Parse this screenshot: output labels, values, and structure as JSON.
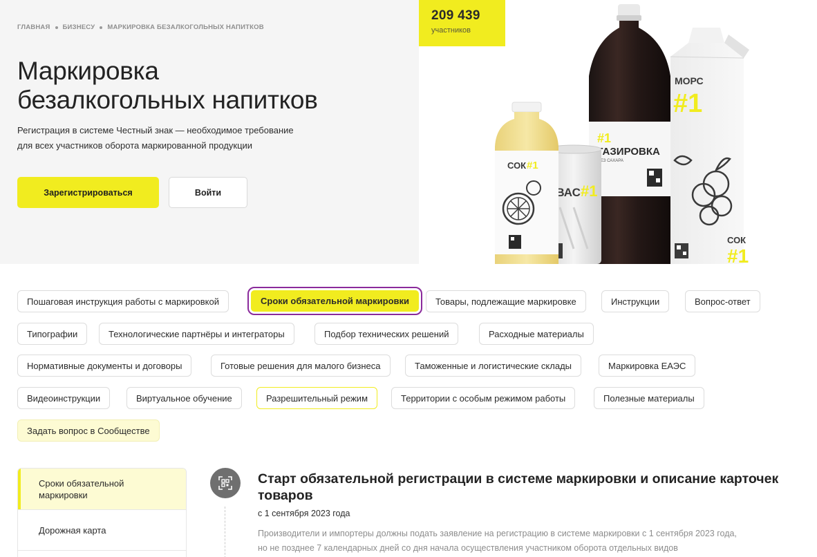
{
  "breadcrumb": {
    "items": [
      "ГЛАВНАЯ",
      "БИЗНЕСУ",
      "МАРКИРОВКА БЕЗАЛКОГОЛЬНЫХ НАПИТКОВ"
    ]
  },
  "hero": {
    "title_line1": "Маркировка",
    "title_line2": "безалкогольных напитков",
    "description_line1": "Регистрация в системе Честный знак — необходимое требование",
    "description_line2": "для всех участников оборота маркированной продукции",
    "register_label": "Зарегистрироваться",
    "login_label": "Войти"
  },
  "counter": {
    "number": "209 439",
    "label": "участников"
  },
  "products": {
    "juice_small_label": "СОК",
    "juice_small_num": "#1",
    "kvas_label": "КВАС",
    "kvas_num": "#1",
    "soda_num": "#1",
    "soda_label": "ГАЗИРОВКА",
    "soda_sub": "БЕЗ САХАРА",
    "mors_label": "МОРС",
    "mors_num": "#1",
    "juice_pack_label": "СОК",
    "juice_pack_num": "#1"
  },
  "tags": [
    {
      "label": "Пошаговая инструкция работы с маркировкой"
    },
    {
      "label": "Сроки обязательной маркировки"
    },
    {
      "label": "Товары, подлежащие маркировке"
    },
    {
      "label": "Инструкции"
    },
    {
      "label": "Вопрос-ответ"
    },
    {
      "label": "Типографии"
    },
    {
      "label": "Технологические партнёры и интеграторы"
    },
    {
      "label": "Подбор технических решений"
    },
    {
      "label": "Расходные материалы"
    },
    {
      "label": "Нормативные документы и договоры"
    },
    {
      "label": "Готовые решения для малого бизнеса"
    },
    {
      "label": "Таможенные и логистические склады"
    },
    {
      "label": "Маркировка ЕАЭС"
    },
    {
      "label": "Видеоинструкции"
    },
    {
      "label": "Виртуальное обучение"
    },
    {
      "label": "Разрешительный режим"
    },
    {
      "label": "Территории с особым режимом работы"
    },
    {
      "label": "Полезные материалы"
    },
    {
      "label": "Задать вопрос в Сообществе"
    }
  ],
  "sidebar": {
    "items": [
      {
        "label_line1": "Сроки обязательной",
        "label_line2": "маркировки"
      },
      {
        "label": "Дорожная карта"
      }
    ]
  },
  "news": {
    "title": "Старт обязательной регистрации в системе маркировки и описание карточек товаров",
    "date": "с 1 сентября 2023 года",
    "text_line1": "Производители и импортеры должны подать заявление на регистрацию в системе маркировки с 1 сентября 2023 года,",
    "text_line2": "но не позднее 7 календарных дней со дня начала осуществления участником оборота отдельных видов"
  },
  "colors": {
    "accent": "#f1ec1f",
    "active_outline": "#8a2a9b",
    "soft_accent": "#fdfbd3",
    "hero_bg": "#f5f5f5"
  }
}
